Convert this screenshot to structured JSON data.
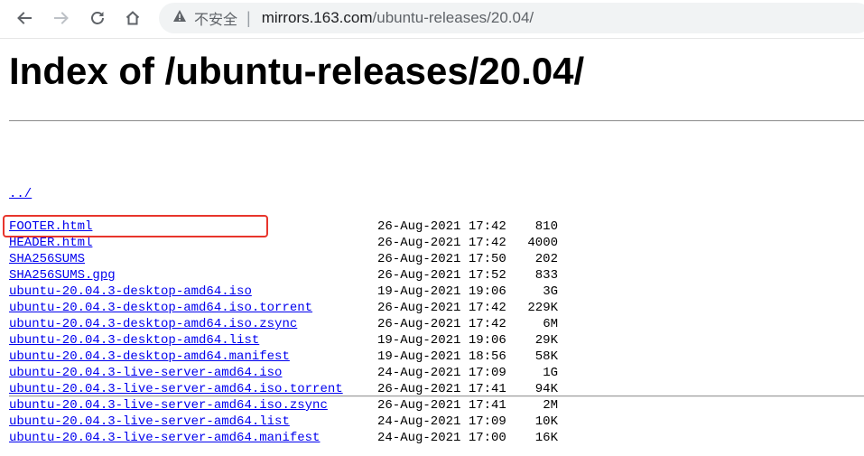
{
  "browser": {
    "security_label": "不安全",
    "url_host": "mirrors.163.com",
    "url_path": "/ubuntu-releases/20.04/"
  },
  "page": {
    "title": "Index of /ubuntu-releases/20.04/",
    "parent_link": "../",
    "files": [
      {
        "name": "FOOTER.html",
        "date": "26-Aug-2021 17:42",
        "size": "810"
      },
      {
        "name": "HEADER.html",
        "date": "26-Aug-2021 17:42",
        "size": "4000"
      },
      {
        "name": "SHA256SUMS",
        "date": "26-Aug-2021 17:50",
        "size": "202"
      },
      {
        "name": "SHA256SUMS.gpg",
        "date": "26-Aug-2021 17:52",
        "size": "833"
      },
      {
        "name": "ubuntu-20.04.3-desktop-amd64.iso",
        "date": "19-Aug-2021 19:06",
        "size": "3G"
      },
      {
        "name": "ubuntu-20.04.3-desktop-amd64.iso.torrent",
        "date": "26-Aug-2021 17:42",
        "size": "229K"
      },
      {
        "name": "ubuntu-20.04.3-desktop-amd64.iso.zsync",
        "date": "26-Aug-2021 17:42",
        "size": "6M"
      },
      {
        "name": "ubuntu-20.04.3-desktop-amd64.list",
        "date": "19-Aug-2021 19:06",
        "size": "29K"
      },
      {
        "name": "ubuntu-20.04.3-desktop-amd64.manifest",
        "date": "19-Aug-2021 18:56",
        "size": "58K"
      },
      {
        "name": "ubuntu-20.04.3-live-server-amd64.iso",
        "date": "24-Aug-2021 17:09",
        "size": "1G"
      },
      {
        "name": "ubuntu-20.04.3-live-server-amd64.iso.torrent",
        "date": "26-Aug-2021 17:41",
        "size": "94K"
      },
      {
        "name": "ubuntu-20.04.3-live-server-amd64.iso.zsync",
        "date": "26-Aug-2021 17:41",
        "size": "2M"
      },
      {
        "name": "ubuntu-20.04.3-live-server-amd64.list",
        "date": "24-Aug-2021 17:09",
        "size": "10K"
      },
      {
        "name": "ubuntu-20.04.3-live-server-amd64.manifest",
        "date": "24-Aug-2021 17:00",
        "size": "16K"
      }
    ]
  },
  "icons": {
    "back": "back-arrow-icon",
    "forward": "forward-arrow-icon",
    "reload": "reload-icon",
    "home": "home-icon",
    "warning": "warning-triangle-icon"
  },
  "colors": {
    "link": "#0000ee",
    "highlight_box": "#e8352c",
    "omnibox_bg": "#f1f3f4"
  }
}
